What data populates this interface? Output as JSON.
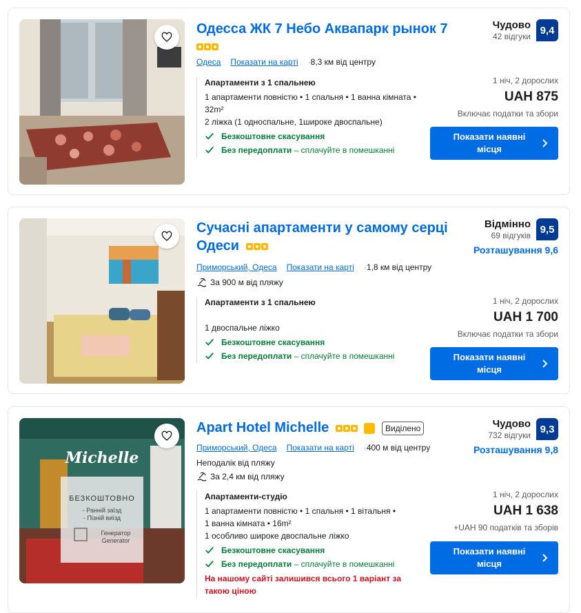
{
  "listings": [
    {
      "title": "Одесса ЖК 7 Небо Аквапарк рынок 7",
      "stars": 3,
      "area": "Одеса",
      "map_link": "Показати на карті",
      "distance": "8,3 км від центру",
      "room_title": "Апартаменти з 1 спальнею",
      "room_lines": [
        "1 апартаменти повністю • 1 спальня • 1 ванна кімната •",
        "32m²",
        "2 ліжка (1 односпальне, 1широке двоспальне)"
      ],
      "free_cancel": "Безкоштовне скасування",
      "no_prepay": "Без передоплати",
      "no_prepay_sub": "– сплачуйте в помешканні",
      "score_label": "Чудово",
      "reviews": "42 відгуки",
      "score": "9,4",
      "nights": "1 ніч, 2 дорослих",
      "price": "UAH 875",
      "taxes": "Включає податки та збори",
      "button": "Показати наявні місця"
    },
    {
      "title_line1": "Сучасні апартаменти у самому серці",
      "title_line2": "Одеси",
      "stars": 3,
      "area": "Приморський, Одеса",
      "map_link": "Показати на карті",
      "distance": "1,8 км від центру",
      "beach": "За 900 м від пляжу",
      "room_title": "Апартаменти з 1 спальнею",
      "room_lines": [
        "1 двоспальне ліжко"
      ],
      "free_cancel": "Безкоштовне скасування",
      "no_prepay": "Без передоплати",
      "no_prepay_sub": "– сплачуйте в помешканні",
      "score_label": "Відмінно",
      "reviews": "69 відгуків",
      "score": "9,5",
      "location_score": "Розташування 9,6",
      "nights": "1 ніч, 2 дорослих",
      "price": "UAH 1 700",
      "taxes": "Включає податки та збори",
      "button": "Показати наявні місця"
    },
    {
      "title": "Apart Hotel Michelle",
      "stars": 3,
      "tag": "Виділено",
      "area": "Приморський, Одеса",
      "map_link": "Показати на карті",
      "distance": "400 м від центру",
      "near_beach": "Неподалік від пляжу",
      "beach": "За 2,4 км від пляжу",
      "room_title": "Апартаменти-студіо",
      "room_lines": [
        "1 апартаменти повністю • 1 спальня • 1 вітальня •",
        "1 ванна кімната • 16m²",
        "1 особливо широке двоспальне ліжко"
      ],
      "free_cancel": "Безкоштовне скасування",
      "no_prepay": "Без передоплати",
      "no_prepay_sub": "– сплачуйте в помешканні",
      "warning": "На нашому сайті залишився всього 1 варіант за такою ціною",
      "score_label": "Чудово",
      "reviews": "732 відгуки",
      "score": "9,3",
      "location_score": "Розташування 9,8",
      "nights": "1 ніч, 2 дорослих",
      "price": "UAH 1 638",
      "taxes": "+UAH 90 податків та зборів",
      "button": "Показати наявні місця",
      "photo_text": {
        "logo": "Michelle",
        "free": "БЕЗКОШТОВНО",
        "perk1": "- Ранній заїзд",
        "perk2": "- Пізній виїзд",
        "gen1": "Генератор",
        "gen2": "Generator"
      }
    }
  ],
  "colors": {
    "accent": "#006ce4",
    "badge": "#003b95",
    "green": "#008234",
    "red": "#d4111e",
    "star": "#ffb700"
  }
}
